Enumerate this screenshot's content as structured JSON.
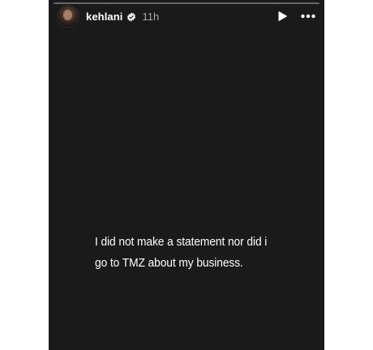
{
  "story": {
    "username": "kehlani",
    "timestamp": "11h",
    "verified": true,
    "progress": 0.0,
    "text_line_1": "I did not make a statement nor did i",
    "text_line_2": "go to TMZ about my business.",
    "background_color": "#1a1a1a"
  },
  "icons": {
    "verified": "verified-badge-icon",
    "play": "play-icon",
    "more": "more-options-icon"
  }
}
